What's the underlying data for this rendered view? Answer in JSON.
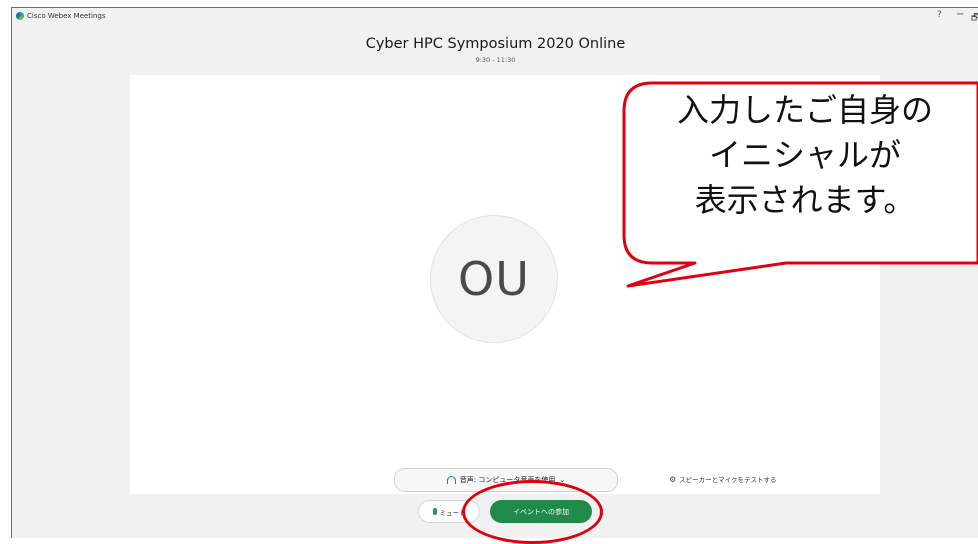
{
  "window": {
    "app_title": "Cisco Webex Meetings",
    "controls": {
      "help": "?",
      "minimize": "−",
      "restore": "🗗"
    }
  },
  "meeting": {
    "title": "Cyber HPC Symposium 2020 Online",
    "time": "9:30 - 11:30"
  },
  "preview": {
    "avatar_initials": "OU"
  },
  "audio": {
    "label": "音声: コンピュータ音声を使用",
    "chevron": "⌄",
    "test_link": "スピーカーとマイクをテストする"
  },
  "actions": {
    "mute_label": "ミュート",
    "join_label": "イベントへの参加"
  },
  "annotation": {
    "callout_text": "入力したご自身の\nイニシャルが\n表示されます。",
    "color": "#e0000f"
  },
  "colors": {
    "join_green": "#1f8a4a",
    "window_bg": "#f1f1f1"
  }
}
